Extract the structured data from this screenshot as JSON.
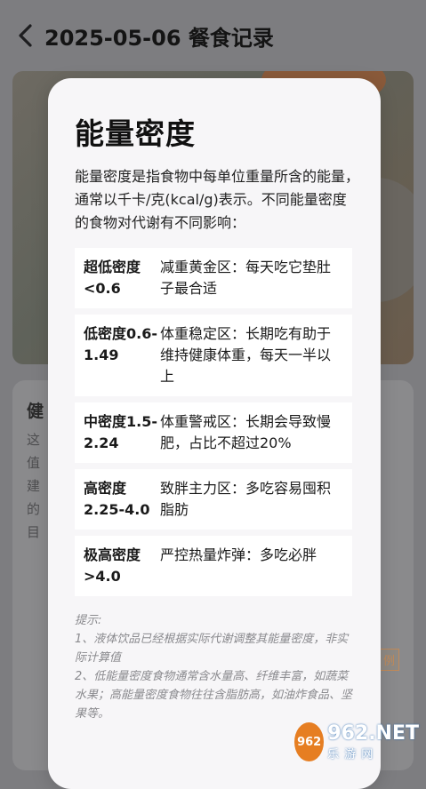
{
  "header": {
    "back_icon": "chevron-left-icon",
    "title": "2025-05-06 餐食记录"
  },
  "modal": {
    "title": "能量密度",
    "description": "能量密度是指食物中每单位重量所含的能量，通常以千卡/克(kcal/g)表示。不同能量密度的食物对代谢有不同影响：",
    "rows": [
      {
        "level": "超低密度<0.6",
        "effect": "减重黄金区：每天吃它垫肚子最合适"
      },
      {
        "level": "低密度0.6-1.49",
        "effect": "体重稳定区：长期吃有助于维持健康体重，每天一半以上"
      },
      {
        "level": "中密度1.5-2.24",
        "effect": "体重警戒区：长期会导致慢肥，占比不超过20%"
      },
      {
        "level": "高密度2.25-4.0",
        "effect": "致胖主力区：多吃容易囤积脂肪"
      },
      {
        "level": "极高密度>4.0",
        "effect": "严控热量炸弹：多吃必胖"
      }
    ],
    "tips_title": "提示:",
    "tips": [
      "1、液体饮品已经根据实际代谢调整其能量密度，非实际计算值",
      "2、低能量密度食物通常含水量高、纤维丰富，如蔬菜水果；高能量密度食物往往含脂肪高，如油炸食品、坚果等。"
    ]
  },
  "background": {
    "card_heading": "健",
    "lines": [
      "这",
      "值",
      "建",
      "的",
      "目"
    ],
    "tag": "例"
  },
  "watermark": {
    "logo_text": "962",
    "main": "962.NET",
    "sub": "乐游网"
  }
}
